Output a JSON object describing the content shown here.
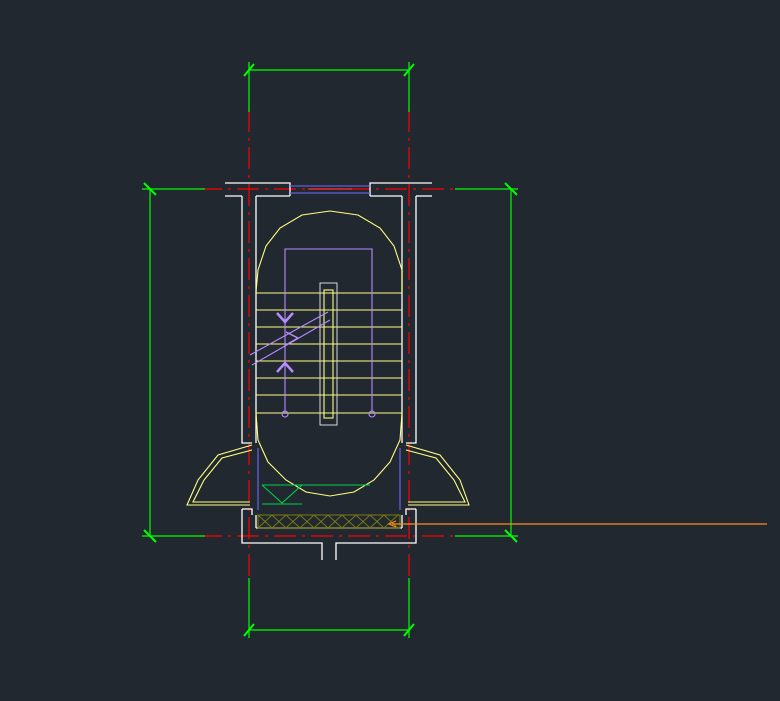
{
  "drawing": {
    "background": "#212830",
    "colors": {
      "walls": "#ffffff",
      "dimensions": "#00ff00",
      "axes": "#ff0000",
      "stairs": "#ffff80",
      "walking_line": "#b98cff",
      "windows": "#6b6bff",
      "leader": "#ff8c1a"
    },
    "elements": [
      "stairwell-plan",
      "dimension-lines",
      "axis-lines",
      "stair-treads",
      "walking-line-arrows",
      "leader-line"
    ]
  }
}
